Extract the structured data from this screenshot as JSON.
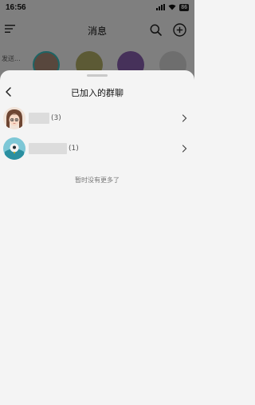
{
  "status_bar": {
    "time": "16:56",
    "battery": "86"
  },
  "header": {
    "title": "消息"
  },
  "story_bar": {
    "partial_text": "发送..."
  },
  "sheet": {
    "title": "已加入的群聊",
    "groups": [
      {
        "count": "(3)"
      },
      {
        "count": "(1)"
      }
    ],
    "empty_note": "暂时没有更多了"
  }
}
